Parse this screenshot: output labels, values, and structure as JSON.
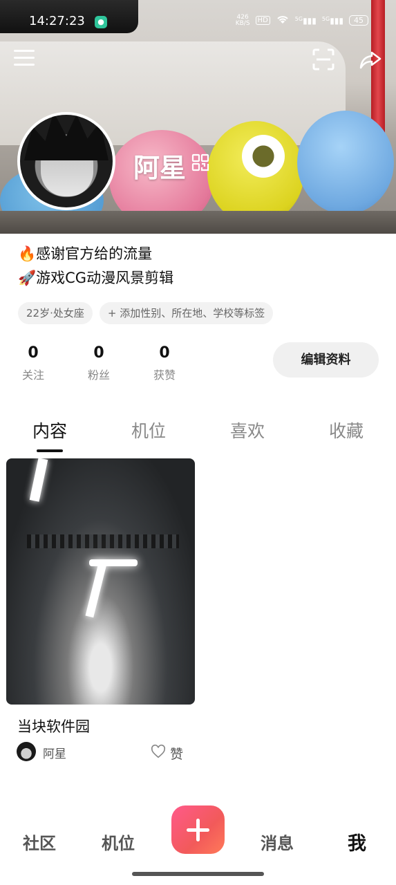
{
  "status_bar": {
    "time": "14:27:23",
    "net_speed_value": "426",
    "net_speed_unit": "KB/S",
    "hd": "HD",
    "signal_1": "5G",
    "signal_2": "5G",
    "battery": "45"
  },
  "profile": {
    "name": "阿星",
    "bio_line_1": "🔥感谢官方给的流量",
    "bio_line_2": "🚀游戏CG动漫风景剪辑",
    "tags": [
      "22岁·处女座",
      "+ 添加性别、所在地、学校等标签"
    ],
    "stats": [
      {
        "value": "0",
        "label": "关注"
      },
      {
        "value": "0",
        "label": "粉丝"
      },
      {
        "value": "0",
        "label": "获赞"
      }
    ],
    "edit_button": "编辑资料"
  },
  "tabs": [
    "内容",
    "机位",
    "喜欢",
    "收藏"
  ],
  "active_tab": "内容",
  "posts": [
    {
      "title": "当块软件园",
      "author": "阿星",
      "like_label": "赞"
    }
  ],
  "bottom_nav": {
    "items": [
      "社区",
      "机位",
      "消息",
      "我"
    ],
    "active": "我"
  },
  "colors": {
    "plus_gradient_start": "#ff5a8a",
    "plus_gradient_end": "#ff7a59",
    "text_primary": "#111111",
    "text_secondary": "#888888"
  }
}
